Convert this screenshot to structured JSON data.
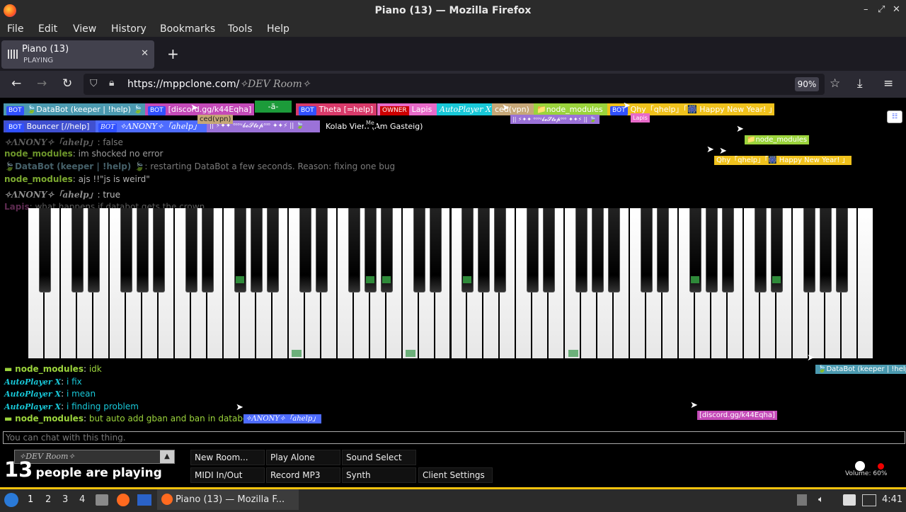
{
  "window": {
    "title": "Piano (13) — Mozilla Firefox"
  },
  "menu": [
    "File",
    "Edit",
    "View",
    "History",
    "Bookmarks",
    "Tools",
    "Help"
  ],
  "tab": {
    "title": "Piano (13)",
    "subtitle": "PLAYING"
  },
  "nav": {
    "url_base": "https://mppclone.com/",
    "url_room": "✧DEV Room✧",
    "zoom": "90%"
  },
  "users": {
    "row1": [
      {
        "badge": "BOT",
        "name": "🍃DataBot (keeper | !help) 🍃",
        "bg": "#4b9ab0"
      },
      {
        "badge": "BOT",
        "name": "[discord.gg/k44Eqha]",
        "bg": "#c44ab8"
      },
      {
        "badge": "",
        "name": "-ä-",
        "bg": "#1c9b3a"
      },
      {
        "badge": "BOT",
        "name": "Theta [=help]",
        "bg": "#d83a6a"
      },
      {
        "badge": "OWNER",
        "name": "Lapis",
        "bg": "#e86ac9"
      },
      {
        "badge": "",
        "name": "AutoPlayer X",
        "bg": "#18c8d8"
      },
      {
        "badge": "",
        "name": "ced(vpn)",
        "bg": "#c6a777"
      },
      {
        "badge": "",
        "name": "📁node_modules",
        "bg": "#9bd43c"
      },
      {
        "badge": "BOT",
        "name": "Qhy「qhelp」「🎆 Happy New Year! 」",
        "bg": "#f0c21c"
      }
    ],
    "row2": [
      {
        "badge": "BOT",
        "name": "Bouncer [//help]",
        "bg": "#4050d0"
      },
      {
        "badge": "BOT",
        "name": "✧ΛNONY✧「ahelp」",
        "bg": "#4e6cff"
      },
      {
        "badge": "",
        "name": "|| ⚡✦✦ ᵒᶦᵒᵘ𝓫𝓮𝓢𝓽𝓮𝓹ᵒᶦᵒ ✦✦⚡ || 🍃",
        "bg": "#9b72d8"
      },
      {
        "badge": "",
        "name": "Kolab Viem (Am Gasteig)",
        "bg": "#000000"
      }
    ]
  },
  "chat_top": [
    {
      "name": "✧ΛNONY✧「ahelp」",
      "msg": "false",
      "color": "#aaa",
      "alpha": 0.55
    },
    {
      "name": "node_modules",
      "msg": "im shocked no error",
      "color": "#9bd43c",
      "alpha": 0.7
    },
    {
      "name": "🍃DataBot (keeper | !help) 🍃",
      "msg": "restarting DataBot a few seconds. Reason: fixing one bug",
      "color": "#7fb0c0",
      "alpha": 0.55
    },
    {
      "name": "node_modules",
      "msg": "ajs !!\"js is weird\"",
      "color": "#9bd43c",
      "alpha": 0.8
    },
    {
      "name": "✧ΛNONY✧「ahelp」",
      "msg": "true",
      "color": "#aaa",
      "alpha": 0.85
    },
    {
      "name": "Lapis",
      "msg": "what happens if databot gets the crown",
      "color": "#e86ac9",
      "alpha": 0.4
    }
  ],
  "chat_bottom": [
    {
      "name": "node_modules",
      "msg": "idk",
      "color": "#9bd43c"
    },
    {
      "name": "AutoPlayer X",
      "msg": "i fix",
      "color": "#18c8d8"
    },
    {
      "name": "AutoPlayer X",
      "msg": "i mean",
      "color": "#18c8d8"
    },
    {
      "name": "AutoPlayer X",
      "msg": "i finding problem",
      "color": "#18c8d8"
    },
    {
      "name": "node_modules",
      "msg": "but auto add gban and ban in databot",
      "color": "#9bd43c"
    }
  ],
  "cursor_labels": [
    {
      "text": "ced(vpn)",
      "bg": "#c6a777"
    },
    {
      "text": "Me",
      "bg": "#000000"
    },
    {
      "text": "|| ⚡✦✦ ᵒᶦᵒᵘ𝓫𝓮𝓢𝓽𝓮𝓹ᵒᶦᵒ ✦✦⚡ || 🍃",
      "bg": "#9b72d8"
    },
    {
      "text": "Lapis",
      "bg": "#e86ac9"
    },
    {
      "text": "📁node_modules",
      "bg": "#9bd43c"
    },
    {
      "text": "Qhy「qhelp」「🎆 Happy New Year! 」",
      "bg": "#f0c21c"
    },
    {
      "text": "🍃DataBot (keeper | !help)",
      "bg": "#4b9ab0"
    },
    {
      "text": "[discord.gg/k44Eqha]",
      "bg": "#c44ab8"
    },
    {
      "text": "✧ΛNONY✧「ahelp」",
      "bg": "#4e6cff"
    }
  ],
  "piano": {
    "white_keys": 52,
    "pressed_green": [
      8,
      14,
      15,
      18,
      28,
      32
    ],
    "pressed_bottom": [
      16,
      23,
      33
    ]
  },
  "bottom": {
    "chat_placeholder": "You can chat with this thing.",
    "room": "✧DEV Room✧",
    "people_count": "13",
    "people_text": "people are playing",
    "buttons_row1": [
      "New Room...",
      "Play Alone",
      "Sound Select"
    ],
    "buttons_row2": [
      "MIDI In/Out",
      "Record MP3",
      "Synth",
      "Client Settings"
    ],
    "volume": "Volume: 60%"
  },
  "taskbar": {
    "workspaces": [
      "1",
      "2",
      "3",
      "4"
    ],
    "window_label": "Piano (13) — Mozilla F...",
    "clock": "4:41"
  }
}
